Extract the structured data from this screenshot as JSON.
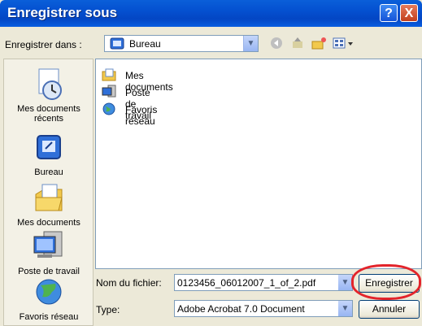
{
  "window": {
    "title": "Enregistrer sous"
  },
  "save_in": {
    "label": "Enregistrer dans :",
    "value": "Bureau"
  },
  "places": [
    {
      "label": "Mes documents récents"
    },
    {
      "label": "Bureau"
    },
    {
      "label": "Mes documents"
    },
    {
      "label": "Poste de travail"
    },
    {
      "label": "Favoris réseau"
    }
  ],
  "files": [
    {
      "label": "Mes documents"
    },
    {
      "label": "Poste de travail"
    },
    {
      "label": "Favoris réseau"
    }
  ],
  "filename": {
    "label": "Nom du fichier:",
    "value": "0123456_06012007_1_of_2.pdf"
  },
  "filetype": {
    "label": "Type:",
    "value": "Adobe Acrobat 7.0 Document"
  },
  "buttons": {
    "save": "Enregistrer",
    "cancel": "Annuler",
    "help": "?",
    "close": "X"
  },
  "colors": {
    "title_bar": "#0450d0",
    "highlight": "#e3242b"
  }
}
